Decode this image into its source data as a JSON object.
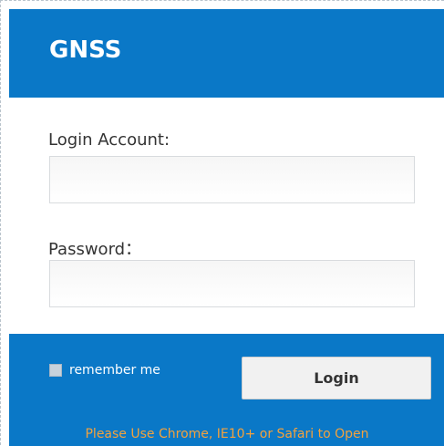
{
  "header": {
    "brand": "GNSS"
  },
  "form": {
    "account_label": "Login Account:",
    "account_value": "",
    "account_placeholder": "",
    "password_label": "Password：",
    "password_value": "",
    "password_placeholder": ""
  },
  "footer": {
    "remember_label": "remember me",
    "remember_checked": false,
    "login_label": "Login",
    "notice": "Please Use Chrome, IE10+ or Safari to Open"
  },
  "colors": {
    "accent_blue": "#0a78c7",
    "button_bg": "#f1f1f1",
    "notice_orange": "#f3a23d"
  }
}
